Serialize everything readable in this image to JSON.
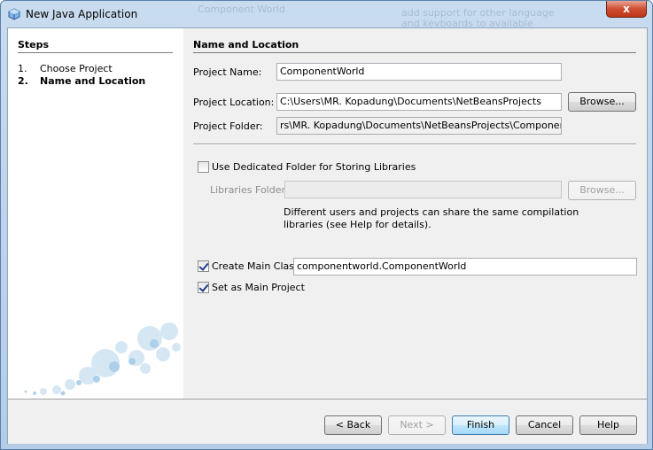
{
  "window": {
    "title": "New Java Application",
    "close_glyph": "x",
    "background_ghost_text": [
      "Component World",
      "add support for other language",
      "and keyboards to available"
    ]
  },
  "steps": {
    "heading": "Steps",
    "items": [
      {
        "num": "1.",
        "label": "Choose Project",
        "active": false
      },
      {
        "num": "2.",
        "label": "Name and Location",
        "active": true
      }
    ]
  },
  "main": {
    "heading": "Name and Location",
    "project_name": {
      "label": "Project Name:",
      "value": "ComponentWorld"
    },
    "project_location": {
      "label": "Project Location:",
      "value": "C:\\Users\\MR. Kopadung\\Documents\\NetBeansProjects",
      "browse": "Browse..."
    },
    "project_folder": {
      "label": "Project Folder:",
      "value": "rs\\MR. Kopadung\\Documents\\NetBeansProjects\\ComponentWorld"
    },
    "dedicated_folder": {
      "label": "Use Dedicated Folder for Storing Libraries",
      "checked": false
    },
    "libraries_folder": {
      "label": "Libraries Folder:",
      "value": "",
      "browse": "Browse..."
    },
    "libraries_help": {
      "line1": "Different users and projects can share the same compilation",
      "line2": "libraries (see Help for details)."
    },
    "create_main_class": {
      "label": "Create Main Class",
      "checked": true,
      "value": "componentworld.ComponentWorld"
    },
    "set_main_project": {
      "label": "Set as Main Project",
      "checked": true
    }
  },
  "footer": {
    "back": "< Back",
    "next": "Next >",
    "finish": "Finish",
    "cancel": "Cancel",
    "help": "Help"
  },
  "colors": {
    "title_gradient_top": "#c9dcef",
    "close_red": "#cf4f33",
    "panel_bg": "#f0f0f0"
  }
}
